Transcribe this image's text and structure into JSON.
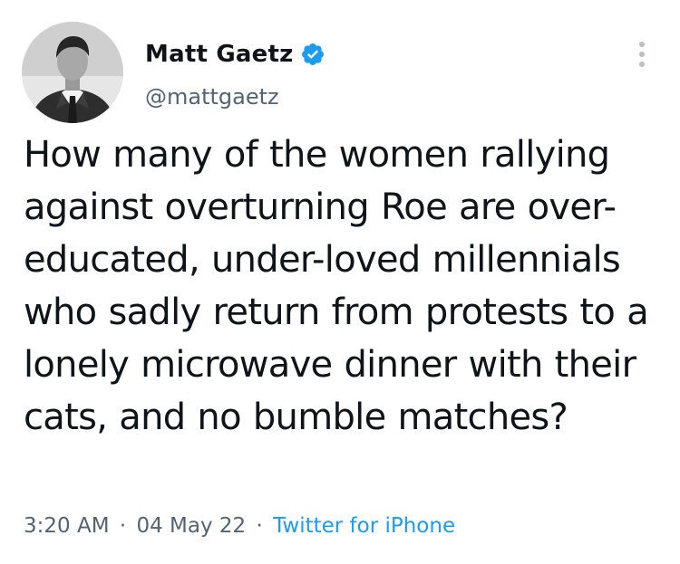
{
  "tweet": {
    "author": {
      "display_name": "Matt Gaetz",
      "handle": "@mattgaetz",
      "verified": true,
      "verified_icon": "verified-badge-icon"
    },
    "text": "How many of the women rallying against overturning Roe are over-educated, under-loved millennials who sadly return from protests to a lonely microwave dinner with their cats, and no bumble matches?",
    "time": "3:20 AM",
    "separator": "·",
    "date": "04 May 22",
    "source": "Twitter for iPhone",
    "more_icon": "more-options-icon"
  },
  "colors": {
    "text_primary": "#0f1419",
    "text_secondary": "#536471",
    "accent": "#1d9bf0",
    "background": "#ffffff"
  }
}
